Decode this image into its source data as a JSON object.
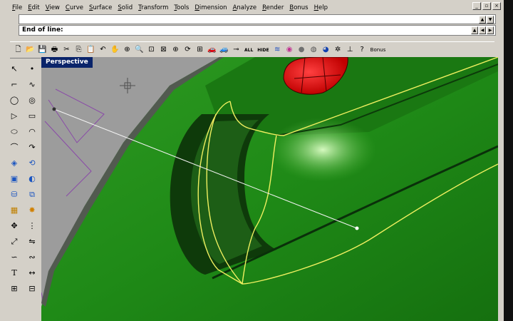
{
  "menu": [
    {
      "first": "F",
      "rest": "ile"
    },
    {
      "first": "E",
      "rest": "dit"
    },
    {
      "first": "V",
      "rest": "iew"
    },
    {
      "first": "C",
      "rest": "urve"
    },
    {
      "first": "S",
      "rest": "urface"
    },
    {
      "first": "S",
      "rest": "olid"
    },
    {
      "first": "T",
      "rest": "ransform"
    },
    {
      "first": "T",
      "rest": "ools"
    },
    {
      "first": "D",
      "rest": "imension"
    },
    {
      "first": "A",
      "rest": "nalyze"
    },
    {
      "first": "R",
      "rest": "ender"
    },
    {
      "first": "B",
      "rest": "onus"
    },
    {
      "first": "H",
      "rest": "elp"
    }
  ],
  "window_controls": {
    "minimize": "_",
    "maximize": "▫",
    "close": "×"
  },
  "command": {
    "history": "",
    "prompt": "End of line",
    "scroll_up": "▲",
    "scroll_down": "▼",
    "scroll_left": "◀",
    "scroll_right": "▶"
  },
  "toolbar": {
    "new": "🗋",
    "open": "📂",
    "save": "💾",
    "print": "🖶",
    "cut": "✂",
    "copy": "⎘",
    "paste": "📋",
    "undo": "↶",
    "pan": "✋",
    "zoom_window": "⊕",
    "zoom_dynamic": "🔍",
    "zoom_extents": "⊡",
    "zoom_selected": "⊠",
    "zoom_in": "⊕",
    "rotate": "⟳",
    "four_view": "⊞",
    "car": "🚗",
    "hide_car": "🚙",
    "show_points": "⊸",
    "all_label": "ALL",
    "hide_label": "HIDE",
    "layers": "≋",
    "color_wheel": "◉",
    "sphere_shaded": "●",
    "sphere_rendered": "◍",
    "sphere_blue": "◕",
    "settings": "✲",
    "dimension": "⊥",
    "help": "?",
    "bonus_label": "Bonus"
  },
  "toolbox": {
    "select": "↖",
    "point": "•",
    "polyline": "⌐",
    "curve": "∿",
    "circle": "◯",
    "circle_center": "◎",
    "polygon": "▷",
    "rectangle": "▭",
    "ellipse": "⬭",
    "arc": "◠",
    "fillet": "⌒",
    "offset": "↷",
    "surface": "◈",
    "revolve": "⟲",
    "box": "▣",
    "sphere": "◐",
    "cylinder": "⛁",
    "boolean": "⧉",
    "point_grid": "▦",
    "explode": "✸",
    "move": "✥",
    "array": "⋮",
    "scale": "⤢",
    "mirror": "⇋",
    "sweep": "∽",
    "blend": "∾",
    "text": "T",
    "dim": "↔",
    "group": "⊞",
    "layout": "⊟",
    "snap": "⌖",
    "analyze": "⌇"
  },
  "viewport": {
    "title": "Perspective"
  },
  "colors": {
    "ui_gray": "#d4d0c8",
    "viewport_title": "#0a246a",
    "surface_green": "#1f8a17",
    "curve_yellow": "#f0f060",
    "lamp_red": "#e00000"
  }
}
